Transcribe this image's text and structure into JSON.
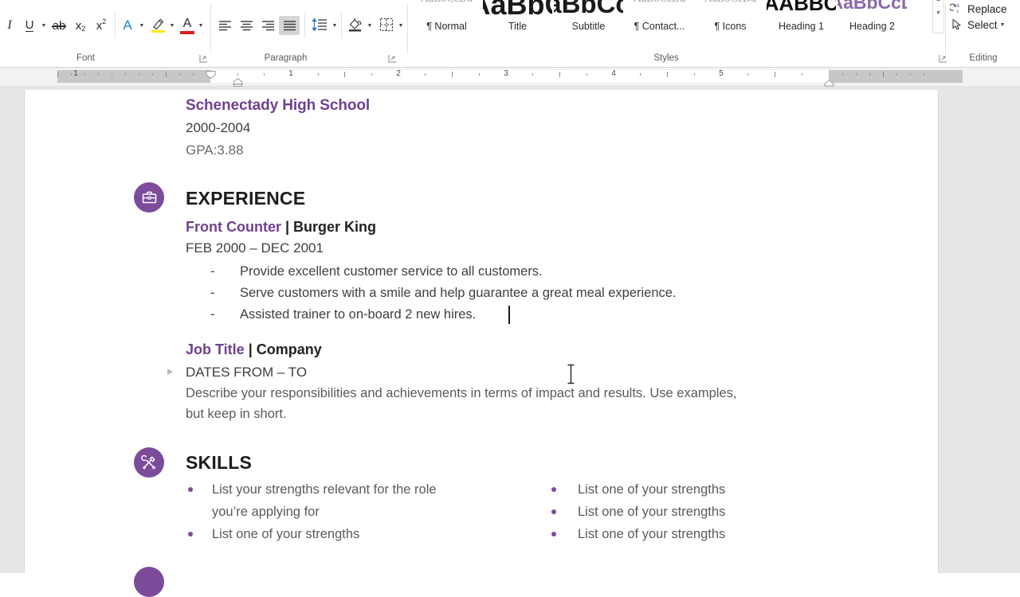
{
  "ribbon": {
    "groups": [
      {
        "name": "font",
        "label": "Font"
      },
      {
        "name": "paragraph",
        "label": "Paragraph"
      },
      {
        "name": "styles",
        "label": "Styles"
      },
      {
        "name": "editing",
        "label": "Editing"
      }
    ],
    "font": {
      "label": "Font",
      "buttons": [
        {
          "name": "italic-button",
          "glyph": "I",
          "title": "Italic"
        },
        {
          "name": "underline-button",
          "glyph": "U",
          "title": "Underline"
        },
        {
          "name": "strikethrough-button",
          "glyph": "ab",
          "title": "Strikethrough"
        },
        {
          "name": "subscript-button",
          "glyph": "x",
          "sup": "2",
          "title": "Subscript"
        },
        {
          "name": "superscript-button",
          "glyph": "x",
          "sup": "2",
          "title": "Superscript"
        },
        {
          "name": "text-effects-button",
          "glyph": "A",
          "title": "Text Effects and Typography"
        },
        {
          "name": "text-highlight-color-button",
          "glyph": "pen",
          "title": "Text Highlight Color"
        },
        {
          "name": "font-color-button",
          "glyph": "A",
          "title": "Font Color"
        }
      ],
      "highlight_color": "#ffe900",
      "font_color": "#d81f1f",
      "effects_color": "#2a7fd4"
    },
    "paragraph": {
      "label": "Paragraph",
      "buttons": [
        {
          "name": "align-left-button",
          "title": "Align Left",
          "active": false
        },
        {
          "name": "align-center-button",
          "title": "Center",
          "active": false
        },
        {
          "name": "align-right-button",
          "title": "Align Right",
          "active": false
        },
        {
          "name": "justify-button",
          "title": "Justify",
          "active": true
        },
        {
          "name": "line-spacing-button",
          "title": "Line and Paragraph Spacing"
        },
        {
          "name": "shading-button",
          "title": "Shading"
        },
        {
          "name": "borders-button",
          "title": "Borders"
        }
      ]
    },
    "styles": {
      "label": "Styles",
      "items": [
        {
          "name": "style-normal",
          "label": "¶ Normal",
          "preview": "AaBbCcDd",
          "preview_style": "normal"
        },
        {
          "name": "style-title",
          "label": "Title",
          "preview": "AaBbC",
          "preview_style": "title"
        },
        {
          "name": "style-subtitle",
          "label": "Subtitle",
          "preview": "AaBbCcD",
          "preview_style": "subtitle"
        },
        {
          "name": "style-contact",
          "label": "¶ Contact...",
          "preview": "AaBbCcDd",
          "preview_style": "contact"
        },
        {
          "name": "style-icons",
          "label": "¶ Icons",
          "preview": "AaBbCcDd",
          "preview_style": "icons"
        },
        {
          "name": "style-heading-1",
          "label": "Heading 1",
          "preview": "AABBC",
          "preview_style": "heading1"
        },
        {
          "name": "style-heading-2",
          "label": "Heading 2",
          "preview": "AaBbCcD",
          "preview_style": "heading2"
        }
      ],
      "scroll_up": "▲",
      "scroll_down": "▼"
    },
    "editing": {
      "label": "Editing",
      "replace_label": "Replace",
      "select_label": "Select"
    }
  },
  "ruler": {
    "numbers": [
      "1",
      "1",
      "2",
      "3",
      "4",
      "5"
    ],
    "left_margin_number": "1"
  },
  "document": {
    "education_block": {
      "school": "Schenectady High School",
      "years": "2000-2004",
      "gpa": "GPA:3.88"
    },
    "experience": {
      "heading": "EXPERIENCE",
      "icon": "briefcase-icon",
      "entries": [
        {
          "title": "Front Counter",
          "separator": " | ",
          "company": "Burger King",
          "dates": "FEB 2000 – DEC 2001",
          "bullet_marker": "-",
          "bullets": [
            "Provide excellent customer service to all customers.",
            "Serve customers with a smile and help guarantee a great meal experience.",
            "Assisted trainer to on-board 2 new hires."
          ]
        },
        {
          "title": "Job Title",
          "separator": " | ",
          "company": "Company",
          "dates": "DATES FROM – TO",
          "description_line1": "Describe your responsibilities and achievements in terms of impact and results. Use examples,",
          "description_line2": "but keep in short."
        }
      ]
    },
    "skills": {
      "heading": "SKILLS",
      "icon": "tools-icon",
      "left_column": [
        "List your strengths relevant for the role",
        "you’re applying for",
        "List one of your strengths"
      ],
      "right_column": [
        "List one of your strengths",
        "List one of your strengths",
        "List one of your strengths"
      ]
    }
  },
  "colors": {
    "accent_purple": "#7c4b9a",
    "heading_purple": "#70418f",
    "body_gray": "#5a5a5a",
    "page_background": "#e6e6e6"
  }
}
